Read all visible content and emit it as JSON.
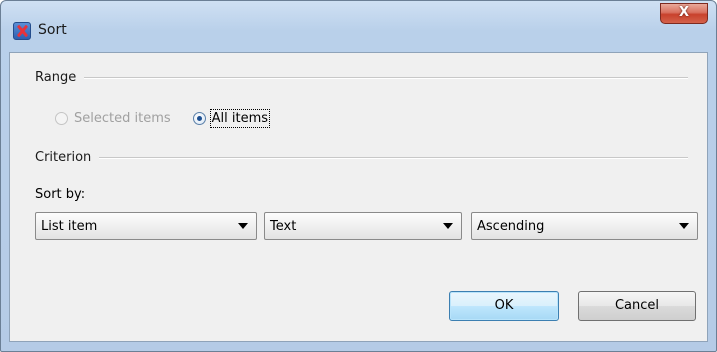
{
  "window": {
    "title": "Sort",
    "close_glyph": "X"
  },
  "range": {
    "label": "Range",
    "options": [
      {
        "label": "Selected items",
        "selected": false,
        "disabled": true
      },
      {
        "label": "All items",
        "selected": true,
        "disabled": false
      }
    ]
  },
  "criterion": {
    "label": "Criterion",
    "sort_by_label": "Sort by:",
    "selects": [
      {
        "value": "List item"
      },
      {
        "value": "Text"
      },
      {
        "value": "Ascending"
      }
    ]
  },
  "buttons": {
    "ok": "OK",
    "cancel": "Cancel"
  },
  "colors": {
    "title_bar": "#b9d0ea",
    "close_button": "#c8412c",
    "client_bg": "#f0f0f0"
  }
}
